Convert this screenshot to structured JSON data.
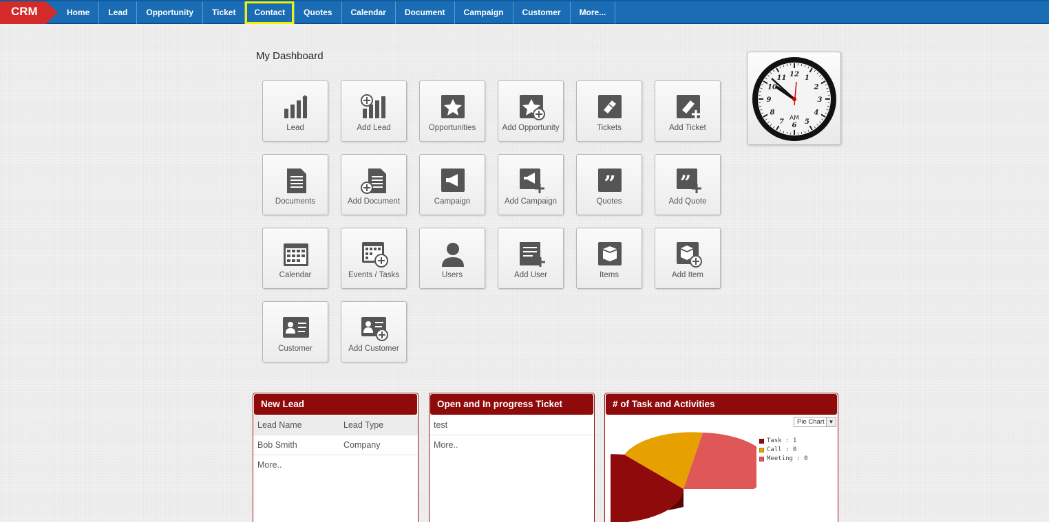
{
  "brand": "CRM",
  "nav": [
    {
      "label": "Home",
      "active": false
    },
    {
      "label": "Lead",
      "active": false
    },
    {
      "label": "Opportunity",
      "active": false
    },
    {
      "label": "Ticket",
      "active": false
    },
    {
      "label": "Contact",
      "active": true
    },
    {
      "label": "Quotes",
      "active": false
    },
    {
      "label": "Calendar",
      "active": false
    },
    {
      "label": "Document",
      "active": false
    },
    {
      "label": "Campaign",
      "active": false
    },
    {
      "label": "Customer",
      "active": false
    },
    {
      "label": "More...",
      "active": false
    }
  ],
  "page_title": "My Dashboard",
  "tiles": [
    {
      "label": "Lead",
      "icon": "bar-chart-icon"
    },
    {
      "label": "Add Lead",
      "icon": "add-chart-icon"
    },
    {
      "label": "Opportunities",
      "icon": "star-icon"
    },
    {
      "label": "Add Opportunity",
      "icon": "add-star-icon"
    },
    {
      "label": "Tickets",
      "icon": "ticket-icon"
    },
    {
      "label": "Add Ticket",
      "icon": "add-ticket-icon"
    },
    {
      "label": "Documents",
      "icon": "document-icon"
    },
    {
      "label": "Add Document",
      "icon": "add-document-icon"
    },
    {
      "label": "Campaign",
      "icon": "megaphone-icon"
    },
    {
      "label": "Add Campaign",
      "icon": "add-megaphone-icon"
    },
    {
      "label": "Quotes",
      "icon": "quote-icon"
    },
    {
      "label": "Add Quote",
      "icon": "add-quote-icon"
    },
    {
      "label": "Calendar",
      "icon": "calendar-icon"
    },
    {
      "label": "Events / Tasks",
      "icon": "add-calendar-icon"
    },
    {
      "label": "Users",
      "icon": "user-icon"
    },
    {
      "label": "Add User",
      "icon": "add-user-icon"
    },
    {
      "label": "Items",
      "icon": "box-icon"
    },
    {
      "label": "Add Item",
      "icon": "add-box-icon"
    },
    {
      "label": "Customer",
      "icon": "contact-card-icon"
    },
    {
      "label": "Add Customer",
      "icon": "add-contact-card-icon"
    }
  ],
  "clock": {
    "am_pm": "AM",
    "numerals": [
      "12",
      "1",
      "2",
      "3",
      "4",
      "5",
      "6",
      "7",
      "8",
      "9",
      "10",
      "11"
    ]
  },
  "widgets": {
    "new_lead": {
      "title": "New Lead",
      "columns": [
        "Lead Name",
        "Lead Type"
      ],
      "rows": [
        [
          "Bob Smith",
          "Company"
        ]
      ],
      "more": "More.."
    },
    "tickets": {
      "title": "Open and In progress Ticket",
      "rows": [
        "test"
      ],
      "more": "More.."
    },
    "tasks": {
      "title": "# of Task and Activities",
      "chart_select": "Pie Chart",
      "legend": [
        {
          "label": "Task : 1",
          "color": "#8f0a0a"
        },
        {
          "label": "Call : 0",
          "color": "#e6a000"
        },
        {
          "label": "Meeting : 0",
          "color": "#df5757"
        }
      ]
    }
  },
  "colors": {
    "nav": "#1a6db4",
    "brand": "#d42a2a",
    "widget_head": "#8f0a0a",
    "active_outline": "#f2f200"
  }
}
